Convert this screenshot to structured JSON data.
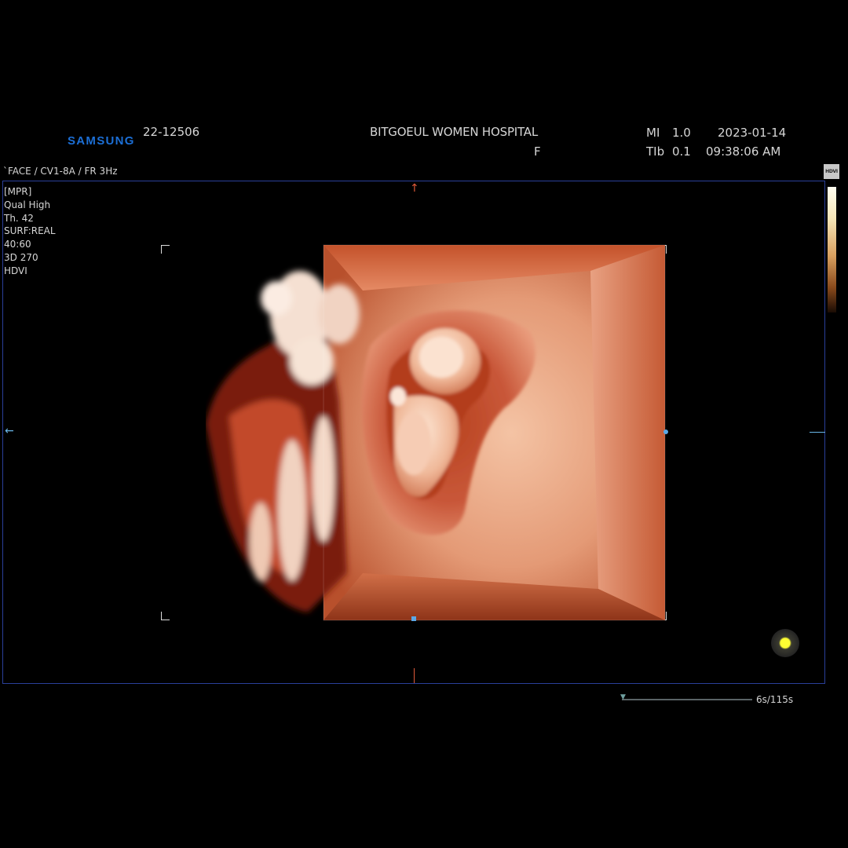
{
  "header": {
    "brand": "SAMSUNG",
    "patient_id": "22-12506",
    "hospital": "BITGOEUL WOMEN HOSPITAL",
    "sex": "F",
    "mi_label": "MI",
    "mi_value": "1.0",
    "tib_label": "TIb",
    "tib_value": "0.1",
    "date": "2023-01-14",
    "time": "09:38:06 AM"
  },
  "probe_line": "`FACE / CV1-8A / FR 3Hz",
  "params": [
    "[MPR]",
    "Qual High",
    "Th. 42",
    "SURF:REAL",
    "40:60",
    "3D 270",
    "HDVI"
  ],
  "colorbar_tag": "HDVI",
  "cine": {
    "counter": "6s/115s"
  },
  "icons": {
    "orientation_top": "arrow-up-icon",
    "orientation_left": "arrow-left-icon",
    "cursor": "trackball-cursor-icon",
    "playhead": "playhead-icon"
  },
  "colors": {
    "brand": "#1c6fd6",
    "frame_border": "#2a3f9a",
    "orientation_marker": "#e05a3a",
    "axis_marker": "#6ab6e8",
    "cursor": "#ffff33"
  }
}
